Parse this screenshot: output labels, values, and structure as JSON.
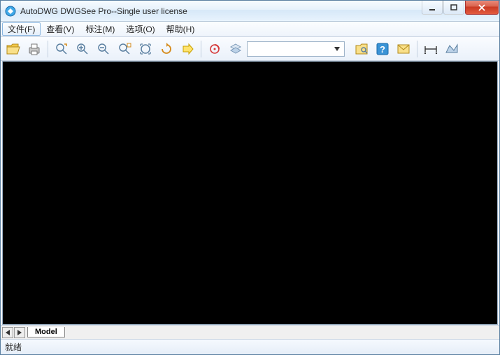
{
  "title": "AutoDWG DWGSee Pro--Single user license",
  "menus": {
    "file": "文件(F)",
    "view": "查看(V)",
    "markup": "标注(M)",
    "option": "选项(O)",
    "help": "帮助(H)"
  },
  "toolbar": {
    "combo_value": ""
  },
  "tabs": {
    "model": "Model"
  },
  "status": {
    "ready": "就绪"
  },
  "colors": {
    "accent": "#3a93d6",
    "close": "#d9503a"
  }
}
